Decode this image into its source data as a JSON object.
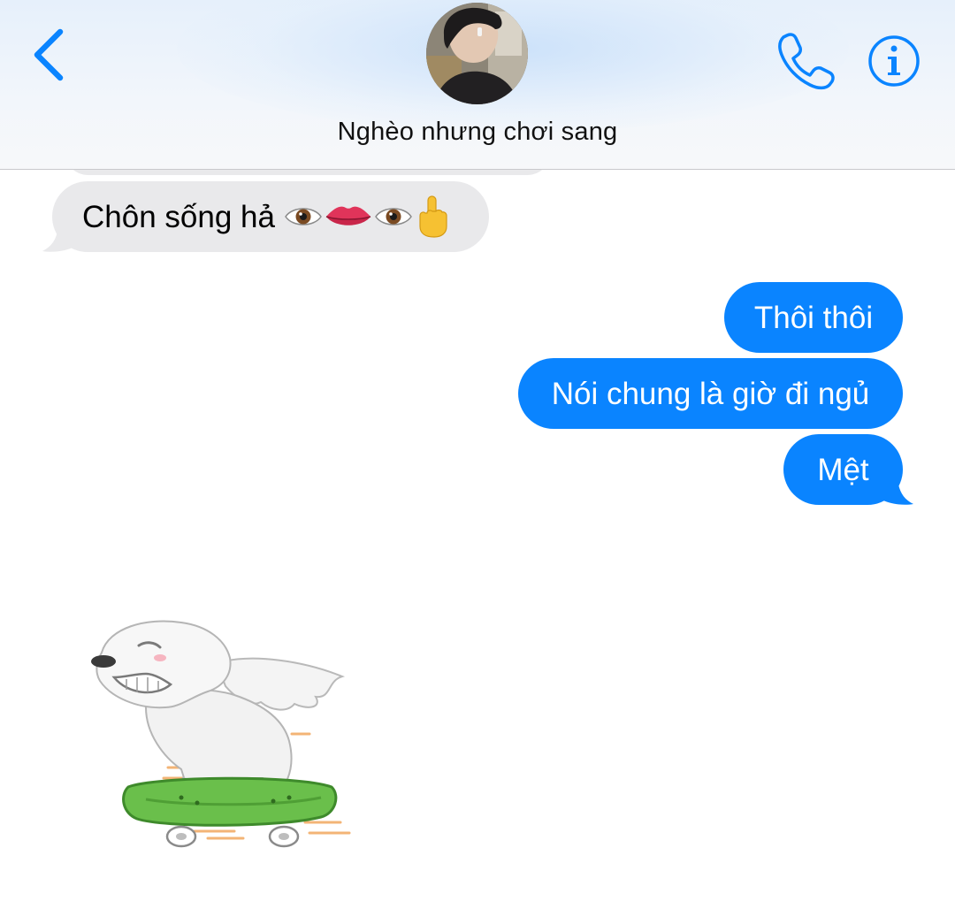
{
  "header": {
    "contact_name": "Nghèo nhưng chơi sang",
    "back_icon": "chevron-left-icon",
    "call_icon": "phone-icon",
    "info_icon": "info-icon",
    "accent_color": "#0a84ff"
  },
  "messages": [
    {
      "direction": "incoming",
      "text": "Chôn sống hả",
      "emojis": [
        "eye",
        "lips",
        "eye",
        "middle-finger"
      ]
    },
    {
      "direction": "outgoing",
      "text": "Thôi thôi"
    },
    {
      "direction": "outgoing",
      "text": "Nói chung là giờ đi ngủ"
    },
    {
      "direction": "outgoing",
      "text": "Mệt"
    },
    {
      "direction": "incoming",
      "type": "sticker",
      "sticker": "white-dog-on-skateboard"
    }
  ],
  "colors": {
    "incoming_bubble": "#e9e9eb",
    "outgoing_bubble": "#0a84ff"
  }
}
